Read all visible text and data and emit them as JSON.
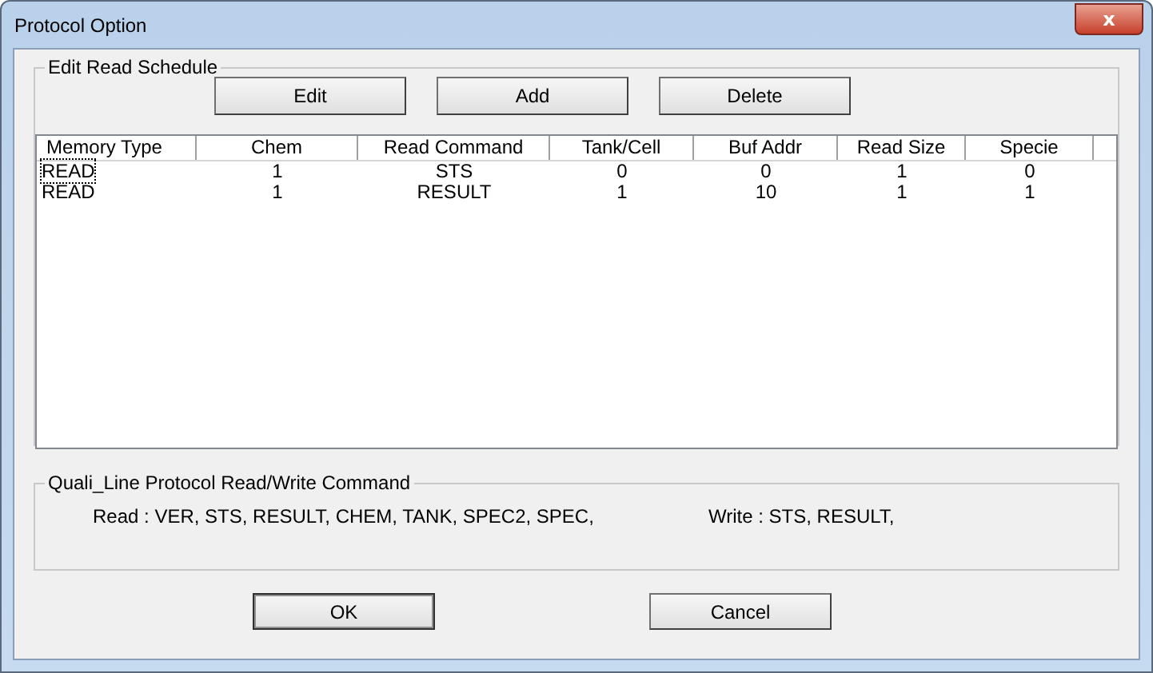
{
  "window": {
    "title": "Protocol Option",
    "close": "x"
  },
  "schedule": {
    "title": "Edit Read Schedule",
    "buttons": [
      "Edit",
      "Add",
      "Delete"
    ],
    "columns": [
      "Memory Type",
      "Chem",
      "Read Command",
      "Tank/Cell",
      "Buf Addr",
      "Read Size",
      "Specie"
    ],
    "rows": [
      {
        "focused": true,
        "cells": [
          "READ",
          "1",
          "STS",
          "0",
          "0",
          "1",
          "0"
        ]
      },
      {
        "focused": false,
        "cells": [
          "READ",
          "1",
          "RESULT",
          "1",
          "10",
          "1",
          "1"
        ]
      }
    ]
  },
  "commands": {
    "title": "Quali_Line Protocol Read/Write Command",
    "read": "Read : VER, STS, RESULT, CHEM, TANK, SPEC2, SPEC,",
    "write": "Write : STS, RESULT,"
  },
  "buttons": [
    "OK",
    "Cancel"
  ]
}
